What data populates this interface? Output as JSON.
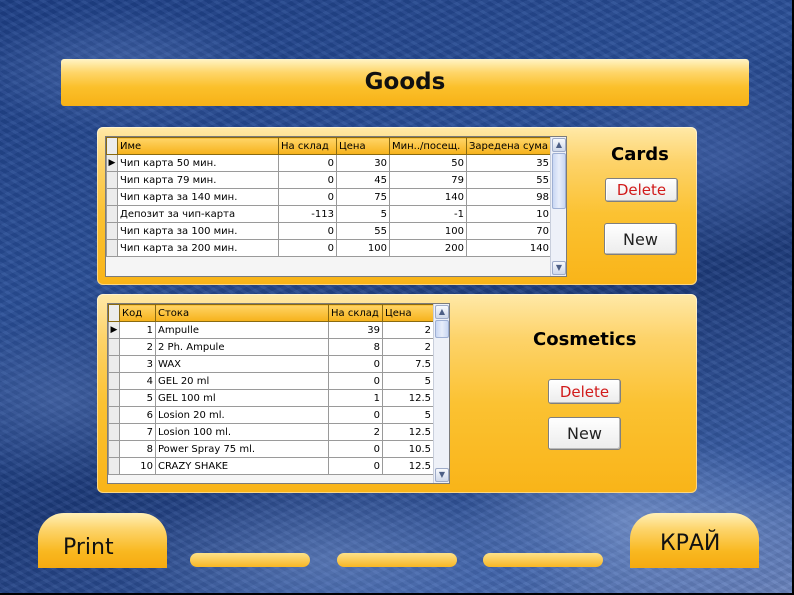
{
  "title": "Goods",
  "cards": {
    "label": "Cards",
    "delete_label": "Delete",
    "new_label": "New",
    "columns": [
      "Име",
      "На склад",
      "Цена",
      "Мин../посещ.",
      "Заредена сума"
    ],
    "rows": [
      [
        "Чип карта 50 мин.",
        "0",
        "30",
        "50",
        "35"
      ],
      [
        "Чип карта  79 мин.",
        "0",
        "45",
        "79",
        "55"
      ],
      [
        "Чип карта за 140 мин.",
        "0",
        "75",
        "140",
        "98"
      ],
      [
        "Депозит за   чип-карта",
        "-113",
        "5",
        "-1",
        "10"
      ],
      [
        "Чип карта за 100 мин.",
        "0",
        "55",
        "100",
        "70"
      ],
      [
        "Чип карта за 200 мин.",
        "0",
        "100",
        "200",
        "140"
      ]
    ]
  },
  "cosmetics": {
    "label": "Cosmetics",
    "delete_label": "Delete",
    "new_label": "New",
    "columns": [
      "Код",
      "Стока",
      "На склад",
      "Цена"
    ],
    "rows": [
      [
        "1",
        "Ampulle",
        "39",
        "2"
      ],
      [
        "2",
        "2 Ph. Ampule",
        "8",
        "2"
      ],
      [
        "3",
        "WAX",
        "0",
        "7.5"
      ],
      [
        "4",
        "GEL 20 ml",
        "0",
        "5"
      ],
      [
        "5",
        "GEL 100 ml",
        "1",
        "12.5"
      ],
      [
        "6",
        "Losion 20 ml.",
        "0",
        "5"
      ],
      [
        "7",
        "Losion 100 ml.",
        "2",
        "12.5"
      ],
      [
        "8",
        "Power Spray 75 ml.",
        "0",
        "10.5"
      ],
      [
        "10",
        "CRAZY SHAKE",
        "0",
        "12.5"
      ]
    ]
  },
  "footer": {
    "print_label": "Print",
    "exit_label": "КРАЙ"
  },
  "colors": {
    "accent": "#fbc232",
    "delete_text": "#d11a1a",
    "background": "#1d3f86"
  }
}
